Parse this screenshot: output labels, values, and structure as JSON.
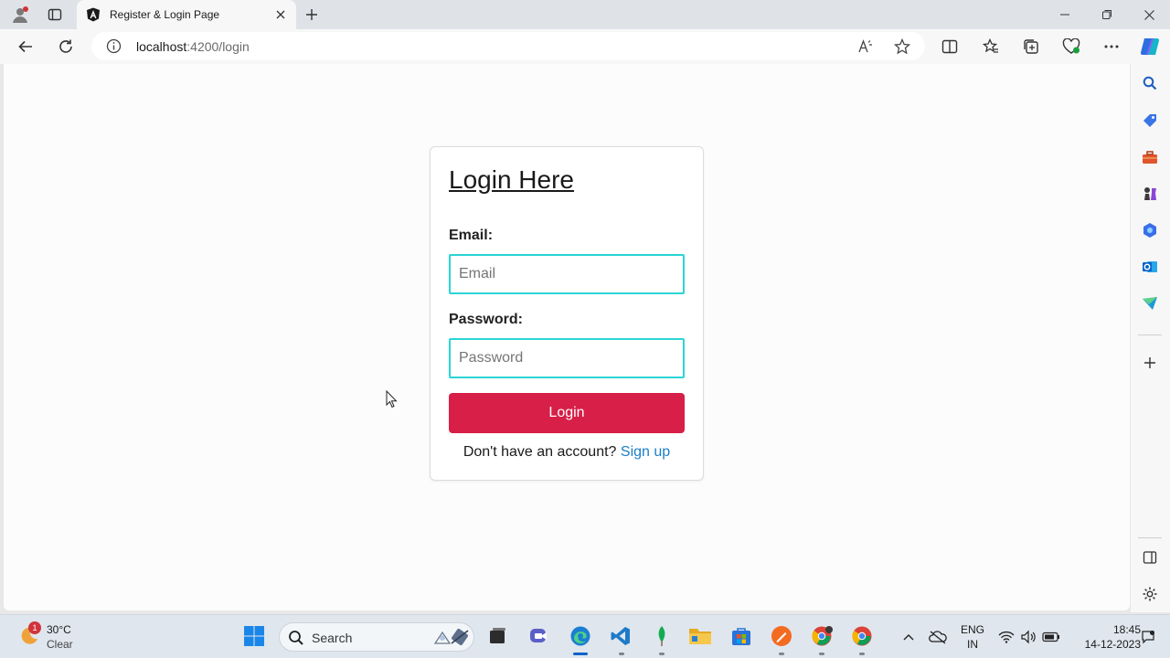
{
  "browser": {
    "tab_title": "Register & Login Page",
    "url_host": "localhost",
    "url_rest": ":4200/login"
  },
  "form": {
    "heading": "Login Here",
    "email_label": "Email:",
    "email_placeholder": "Email",
    "password_label": "Password:",
    "password_placeholder": "Password",
    "login_button": "Login",
    "signup_prompt": "Don't have an account? ",
    "signup_link": "Sign up",
    "accent_input_border": "#2bd5d6",
    "accent_button": "#d71f48",
    "accent_link": "#1a7fc8"
  },
  "sidebar": {
    "icons": [
      "search-icon",
      "tag-icon",
      "toolbox-icon",
      "chess-icon",
      "copilot-apps-icon",
      "outlook-icon",
      "send-icon",
      "add-icon",
      "split-panel-icon",
      "settings-icon"
    ]
  },
  "taskbar": {
    "weather_badge": "1",
    "weather_temp": "30°C",
    "weather_condition": "Clear",
    "search_label": "Search",
    "lang_top": "ENG",
    "lang_bottom": "IN",
    "time": "18:45",
    "date": "14-12-2023",
    "apps": [
      "windows-start-icon",
      "search-icon",
      "task-view-icon",
      "teams-icon",
      "edge-icon",
      "vscode-icon",
      "mongodb-icon",
      "file-explorer-icon",
      "store-icon",
      "paint-icon",
      "chrome-profile-icon",
      "chrome-icon"
    ]
  }
}
